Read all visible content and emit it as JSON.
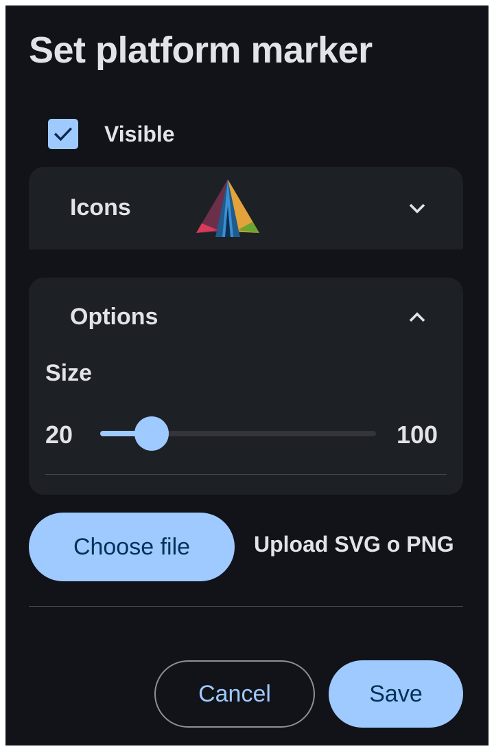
{
  "dialog": {
    "title": "Set platform marker",
    "visible_checkbox": {
      "label": "Visible",
      "checked": true
    }
  },
  "icons_panel": {
    "title": "Icons",
    "expanded": false,
    "selected_icon": "tent-icon",
    "chevron": "chevron-down-icon"
  },
  "options_panel": {
    "title": "Options",
    "expanded": true,
    "chevron": "chevron-up-icon",
    "size": {
      "label": "Size",
      "min_label": "20",
      "max_label": "100",
      "min": 20,
      "max": 100,
      "value": 35
    }
  },
  "upload": {
    "button_label": "Choose file",
    "hint": "Upload SVG o PNG"
  },
  "footer": {
    "cancel_label": "Cancel",
    "save_label": "Save"
  },
  "colors": {
    "surface": "#111318",
    "panel": "#1d2024",
    "primary": "#9ecaff",
    "on_primary": "#003258",
    "text": "#e2e2e9",
    "outline": "#8e9099"
  }
}
